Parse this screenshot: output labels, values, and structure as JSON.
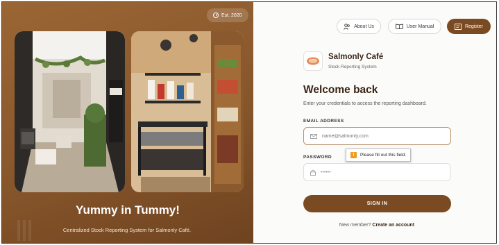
{
  "left_panel": {
    "badge": "Est. 2020",
    "headline": "Yummy in Tummy!",
    "subheadline": "Centralized Stock Reporting System for Salmonly Café.",
    "accent_color": "#87562b",
    "photos": [
      {
        "icon": "cafe-entrance-photo"
      },
      {
        "icon": "cafe-interior-photo"
      }
    ]
  },
  "nav": {
    "about": "About Us",
    "manual": "User Manual",
    "register": "Register"
  },
  "brand": {
    "name": "Salmonly Café",
    "tagline": "Stock Reporting System"
  },
  "login": {
    "title": "Welcome back",
    "subtitle": "Enter your credentials to access the reporting dashboard.",
    "email_label": "EMAIL ADDRESS",
    "email_placeholder": "name@salmonly.com",
    "password_label": "PASSWORD",
    "password_value": "••••••",
    "validation_message": "Please fill out this field.",
    "submit": "SIGN IN",
    "footer_text": "New member?",
    "footer_link": "Create an account"
  },
  "colors": {
    "primary": "#7a4b22",
    "warning": "#f29a1c"
  }
}
